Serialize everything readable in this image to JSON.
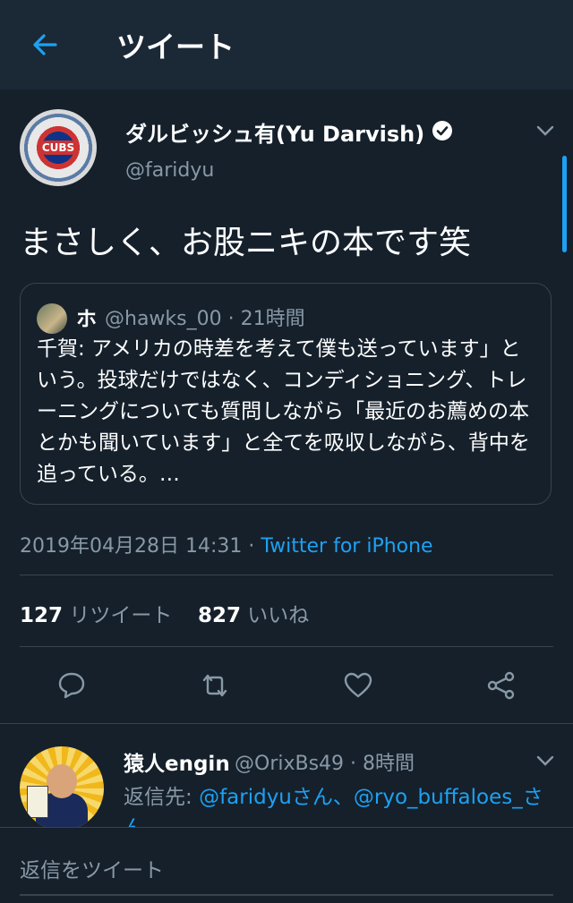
{
  "header": {
    "title": "ツイート"
  },
  "tweet": {
    "author_name": "ダルビッシュ有(Yu Darvish)",
    "author_handle": "@faridyu",
    "avatar_text": "CUBS",
    "text": "まさしく、お股ニキの本です笑",
    "quoted": {
      "name": "ホ",
      "meta": "@hawks_00 · 21時間",
      "body": "千賀: アメリカの時差を考えて僕も送っています」という。投球だけではなく、コンディショニング、トレーニングについても質問しながら「最近のお薦めの本とかも聞いています」と全てを吸収しながら、背中を追っている。…"
    },
    "timestamp": "2019年04月28日 14:31 · ",
    "source": "Twitter for iPhone",
    "retweets": "127",
    "retweets_label": "リツイート",
    "likes": "827",
    "likes_label": "いいね"
  },
  "reply": {
    "name": "猿人engin",
    "meta": "@OrixBs49 · 8時間",
    "reply_prefix": "返信先: ",
    "reply_link": "@faridyuさん、@ryo_buffaloes_さん"
  },
  "composer": {
    "placeholder": "返信をツイート"
  },
  "colors": {
    "accent": "#1da1f2",
    "background": "#15202b",
    "muted": "#8899a6"
  }
}
